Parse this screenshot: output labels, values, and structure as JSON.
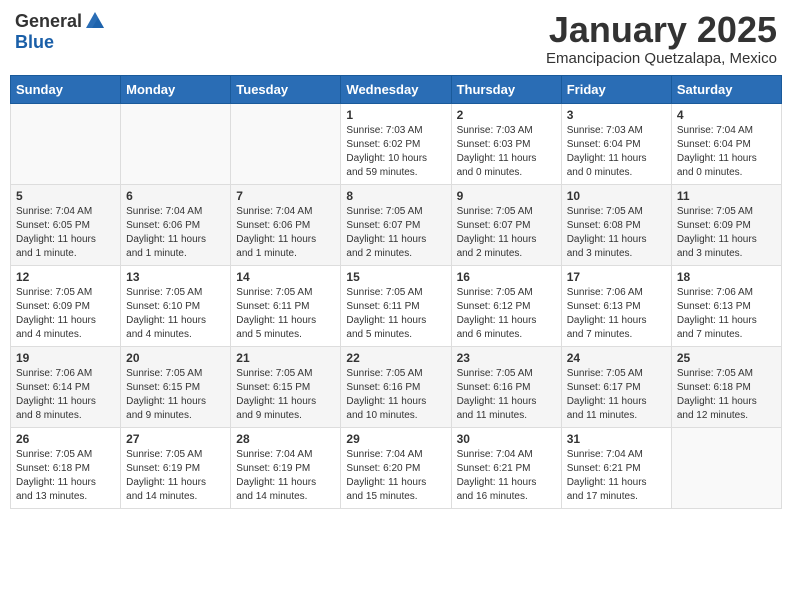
{
  "header": {
    "logo_general": "General",
    "logo_blue": "Blue",
    "month": "January 2025",
    "location": "Emancipacion Quetzalapa, Mexico"
  },
  "weekdays": [
    "Sunday",
    "Monday",
    "Tuesday",
    "Wednesday",
    "Thursday",
    "Friday",
    "Saturday"
  ],
  "weeks": [
    [
      {
        "day": "",
        "content": ""
      },
      {
        "day": "",
        "content": ""
      },
      {
        "day": "",
        "content": ""
      },
      {
        "day": "1",
        "content": "Sunrise: 7:03 AM\nSunset: 6:02 PM\nDaylight: 10 hours\nand 59 minutes."
      },
      {
        "day": "2",
        "content": "Sunrise: 7:03 AM\nSunset: 6:03 PM\nDaylight: 11 hours\nand 0 minutes."
      },
      {
        "day": "3",
        "content": "Sunrise: 7:03 AM\nSunset: 6:04 PM\nDaylight: 11 hours\nand 0 minutes."
      },
      {
        "day": "4",
        "content": "Sunrise: 7:04 AM\nSunset: 6:04 PM\nDaylight: 11 hours\nand 0 minutes."
      }
    ],
    [
      {
        "day": "5",
        "content": "Sunrise: 7:04 AM\nSunset: 6:05 PM\nDaylight: 11 hours\nand 1 minute."
      },
      {
        "day": "6",
        "content": "Sunrise: 7:04 AM\nSunset: 6:06 PM\nDaylight: 11 hours\nand 1 minute."
      },
      {
        "day": "7",
        "content": "Sunrise: 7:04 AM\nSunset: 6:06 PM\nDaylight: 11 hours\nand 1 minute."
      },
      {
        "day": "8",
        "content": "Sunrise: 7:05 AM\nSunset: 6:07 PM\nDaylight: 11 hours\nand 2 minutes."
      },
      {
        "day": "9",
        "content": "Sunrise: 7:05 AM\nSunset: 6:07 PM\nDaylight: 11 hours\nand 2 minutes."
      },
      {
        "day": "10",
        "content": "Sunrise: 7:05 AM\nSunset: 6:08 PM\nDaylight: 11 hours\nand 3 minutes."
      },
      {
        "day": "11",
        "content": "Sunrise: 7:05 AM\nSunset: 6:09 PM\nDaylight: 11 hours\nand 3 minutes."
      }
    ],
    [
      {
        "day": "12",
        "content": "Sunrise: 7:05 AM\nSunset: 6:09 PM\nDaylight: 11 hours\nand 4 minutes."
      },
      {
        "day": "13",
        "content": "Sunrise: 7:05 AM\nSunset: 6:10 PM\nDaylight: 11 hours\nand 4 minutes."
      },
      {
        "day": "14",
        "content": "Sunrise: 7:05 AM\nSunset: 6:11 PM\nDaylight: 11 hours\nand 5 minutes."
      },
      {
        "day": "15",
        "content": "Sunrise: 7:05 AM\nSunset: 6:11 PM\nDaylight: 11 hours\nand 5 minutes."
      },
      {
        "day": "16",
        "content": "Sunrise: 7:05 AM\nSunset: 6:12 PM\nDaylight: 11 hours\nand 6 minutes."
      },
      {
        "day": "17",
        "content": "Sunrise: 7:06 AM\nSunset: 6:13 PM\nDaylight: 11 hours\nand 7 minutes."
      },
      {
        "day": "18",
        "content": "Sunrise: 7:06 AM\nSunset: 6:13 PM\nDaylight: 11 hours\nand 7 minutes."
      }
    ],
    [
      {
        "day": "19",
        "content": "Sunrise: 7:06 AM\nSunset: 6:14 PM\nDaylight: 11 hours\nand 8 minutes."
      },
      {
        "day": "20",
        "content": "Sunrise: 7:05 AM\nSunset: 6:15 PM\nDaylight: 11 hours\nand 9 minutes."
      },
      {
        "day": "21",
        "content": "Sunrise: 7:05 AM\nSunset: 6:15 PM\nDaylight: 11 hours\nand 9 minutes."
      },
      {
        "day": "22",
        "content": "Sunrise: 7:05 AM\nSunset: 6:16 PM\nDaylight: 11 hours\nand 10 minutes."
      },
      {
        "day": "23",
        "content": "Sunrise: 7:05 AM\nSunset: 6:16 PM\nDaylight: 11 hours\nand 11 minutes."
      },
      {
        "day": "24",
        "content": "Sunrise: 7:05 AM\nSunset: 6:17 PM\nDaylight: 11 hours\nand 11 minutes."
      },
      {
        "day": "25",
        "content": "Sunrise: 7:05 AM\nSunset: 6:18 PM\nDaylight: 11 hours\nand 12 minutes."
      }
    ],
    [
      {
        "day": "26",
        "content": "Sunrise: 7:05 AM\nSunset: 6:18 PM\nDaylight: 11 hours\nand 13 minutes."
      },
      {
        "day": "27",
        "content": "Sunrise: 7:05 AM\nSunset: 6:19 PM\nDaylight: 11 hours\nand 14 minutes."
      },
      {
        "day": "28",
        "content": "Sunrise: 7:04 AM\nSunset: 6:19 PM\nDaylight: 11 hours\nand 14 minutes."
      },
      {
        "day": "29",
        "content": "Sunrise: 7:04 AM\nSunset: 6:20 PM\nDaylight: 11 hours\nand 15 minutes."
      },
      {
        "day": "30",
        "content": "Sunrise: 7:04 AM\nSunset: 6:21 PM\nDaylight: 11 hours\nand 16 minutes."
      },
      {
        "day": "31",
        "content": "Sunrise: 7:04 AM\nSunset: 6:21 PM\nDaylight: 11 hours\nand 17 minutes."
      },
      {
        "day": "",
        "content": ""
      }
    ]
  ]
}
